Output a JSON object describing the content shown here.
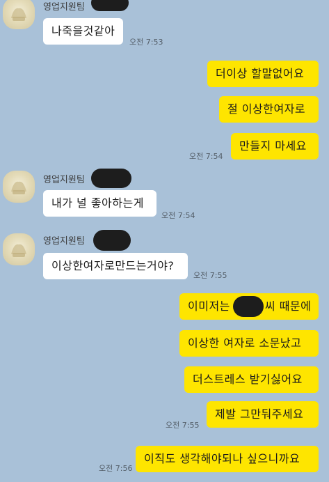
{
  "chat": {
    "colors": {
      "background": "#a9c1d8",
      "incoming_bubble": "#ffffff",
      "outgoing_bubble": "#fee500"
    },
    "sender_name": "영업지원팀",
    "messages": [
      {
        "id": "m1",
        "direction": "incoming",
        "text": "나죽을것같아",
        "time": "오전 7:53"
      },
      {
        "id": "m2",
        "direction": "outgoing",
        "text": "더이상 할말없어요"
      },
      {
        "id": "m3",
        "direction": "outgoing",
        "text": "절 이상한여자로"
      },
      {
        "id": "m4",
        "direction": "outgoing",
        "text": "만들지 마세요",
        "time": "오전 7:54"
      },
      {
        "id": "m5",
        "direction": "incoming",
        "sender": "영업지원팀",
        "text": "내가 널 좋아하는게",
        "time": "오전 7:54"
      },
      {
        "id": "m6",
        "direction": "incoming",
        "sender": "영업지원팀",
        "text": "이상한여자로만드는거야?",
        "time": "오전 7:55"
      },
      {
        "id": "m7",
        "direction": "outgoing",
        "text_before": "이미저는",
        "text_after": "씨 때문에"
      },
      {
        "id": "m8",
        "direction": "outgoing",
        "text": "이상한 여자로 소문났고"
      },
      {
        "id": "m9",
        "direction": "outgoing",
        "text": "더스트레스 받기싫어요"
      },
      {
        "id": "m10",
        "direction": "outgoing",
        "text": "제발 그만둬주세요",
        "time": "오전 7:55"
      },
      {
        "id": "m11",
        "direction": "outgoing",
        "text": "이직도 생각해야되나 싶으니까요",
        "time": "오전 7:56"
      }
    ]
  }
}
